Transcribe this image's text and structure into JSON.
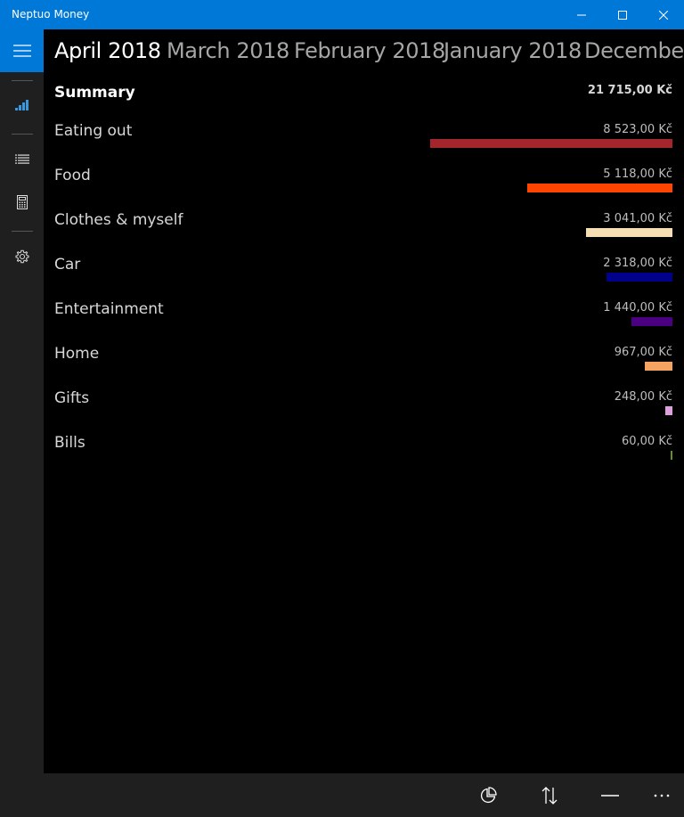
{
  "window": {
    "title": "Neptuo Money"
  },
  "months": [
    {
      "label": "April 2018",
      "active": true
    },
    {
      "label": "March 2018",
      "active": false
    },
    {
      "label": "February 2018",
      "active": false
    },
    {
      "label": "January 2018",
      "active": false
    },
    {
      "label": "December",
      "active": false
    }
  ],
  "summary": {
    "label": "Summary",
    "total": "21 715,00 Kč"
  },
  "categories": [
    {
      "name": "Eating out",
      "amount": "8 523,00 Kč",
      "value": 8523,
      "color": "#a4262c"
    },
    {
      "name": "Food",
      "amount": "5 118,00 Kč",
      "value": 5118,
      "color": "#ff4500"
    },
    {
      "name": "Clothes & myself",
      "amount": "3 041,00 Kč",
      "value": 3041,
      "color": "#f5deb3"
    },
    {
      "name": "Car",
      "amount": "2 318,00 Kč",
      "value": 2318,
      "color": "#00008b"
    },
    {
      "name": "Entertainment",
      "amount": "1 440,00 Kč",
      "value": 1440,
      "color": "#4b0082"
    },
    {
      "name": "Home",
      "amount": "967,00 Kč",
      "value": 967,
      "color": "#f4a460"
    },
    {
      "name": "Gifts",
      "amount": "248,00 Kč",
      "value": 248,
      "color": "#dda0dd"
    },
    {
      "name": "Bills",
      "amount": "60,00 Kč",
      "value": 60,
      "color": "#6b8e23"
    }
  ],
  "rail": {
    "items": [
      {
        "icon": "hamburger-menu-icon"
      },
      {
        "icon": "bar-chart-icon",
        "selected": true
      },
      {
        "icon": "list-icon"
      },
      {
        "icon": "calculator-icon"
      },
      {
        "icon": "gear-icon"
      }
    ]
  },
  "commands": [
    {
      "icon": "pie-chart-icon"
    },
    {
      "icon": "sort-icon"
    },
    {
      "icon": "minus-icon"
    },
    {
      "icon": "more-icon"
    }
  ],
  "colors": {
    "accent": "#0078d7"
  }
}
